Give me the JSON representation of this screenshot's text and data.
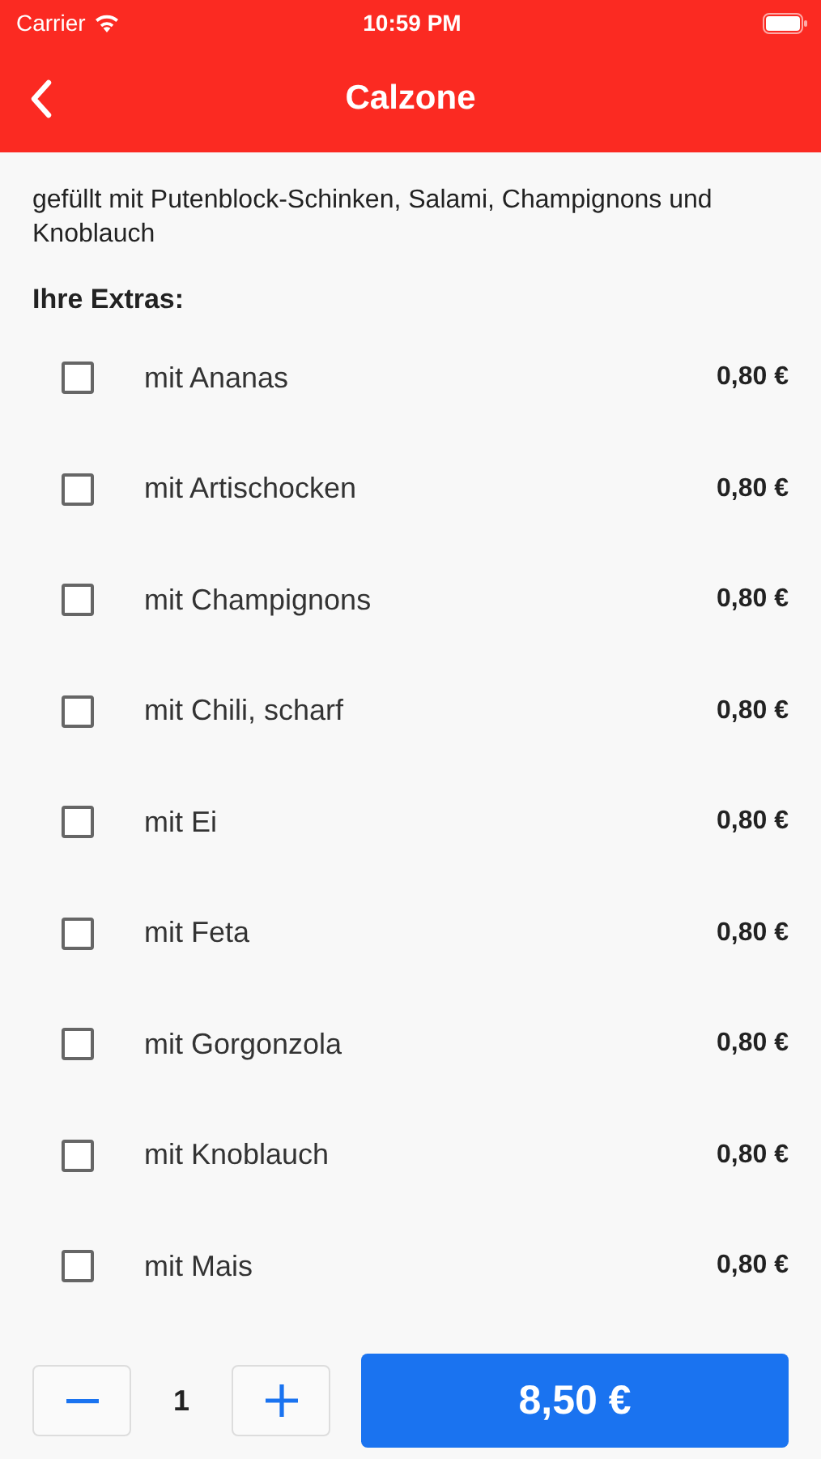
{
  "status_bar": {
    "carrier": "Carrier",
    "time": "10:59 PM"
  },
  "nav": {
    "title": "Calzone"
  },
  "description": "gefüllt mit Putenblock-Schinken, Salami, Champignons und Knoblauch",
  "extras_heading": "Ihre Extras:",
  "extras": [
    {
      "label": "mit Ananas",
      "price": "0,80 €",
      "checked": false
    },
    {
      "label": "mit Artischocken",
      "price": "0,80 €",
      "checked": false
    },
    {
      "label": "mit Champignons",
      "price": "0,80 €",
      "checked": false
    },
    {
      "label": "mit Chili, scharf",
      "price": "0,80 €",
      "checked": false
    },
    {
      "label": "mit Ei",
      "price": "0,80 €",
      "checked": false
    },
    {
      "label": "mit Feta",
      "price": "0,80 €",
      "checked": false
    },
    {
      "label": "mit Gorgonzola",
      "price": "0,80 €",
      "checked": false
    },
    {
      "label": "mit Knoblauch",
      "price": "0,80 €",
      "checked": false
    },
    {
      "label": "mit Mais",
      "price": "0,80 €",
      "checked": false
    }
  ],
  "quantity": "1",
  "total_button": "8,50 €"
}
